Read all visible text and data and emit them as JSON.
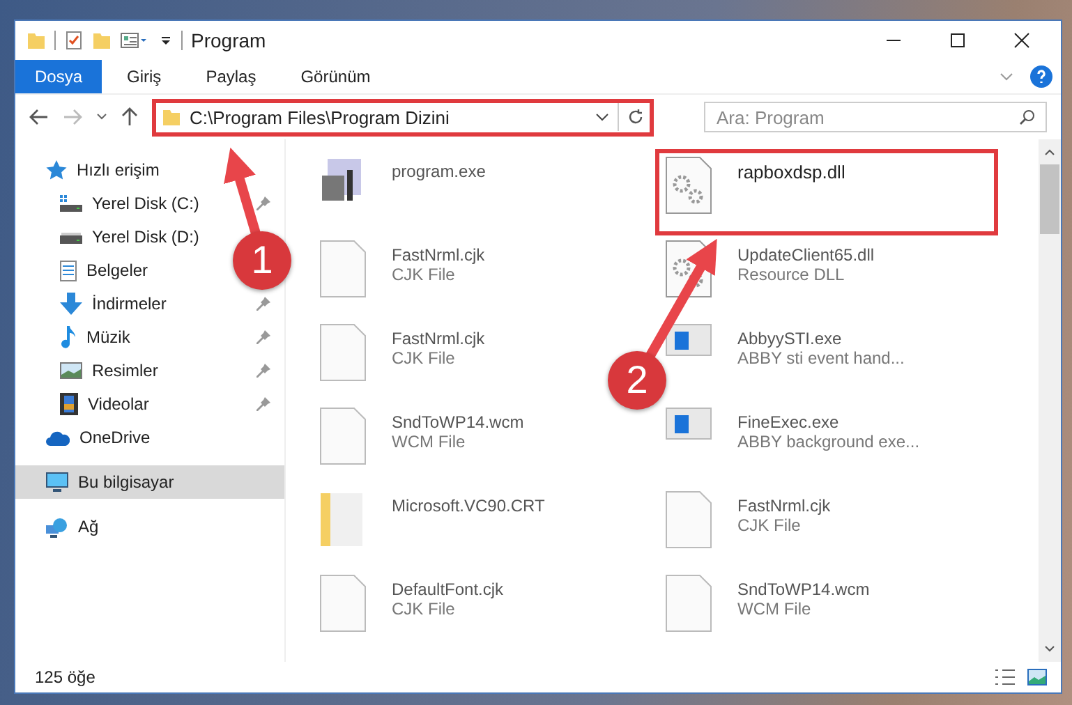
{
  "window": {
    "title": "Program"
  },
  "ribbon_tabs": [
    {
      "label": "Dosya",
      "selected": true
    },
    {
      "label": "Giriş",
      "selected": false
    },
    {
      "label": "Paylaş",
      "selected": false
    },
    {
      "label": "Görünüm",
      "selected": false
    }
  ],
  "address": {
    "path": "C:\\Program Files\\Program Dizini",
    "highlighted": true
  },
  "search": {
    "placeholder": "Ara: Program"
  },
  "sidebar": {
    "items": [
      {
        "label": "Hızlı erişim",
        "selected": false,
        "children": [
          {
            "label": "Yerel Disk (C:)",
            "pinned": true
          },
          {
            "label": "Yerel Disk (D:)",
            "pinned": false
          },
          {
            "label": "Belgeler",
            "pinned": false
          },
          {
            "label": "İndirmeler",
            "pinned": true
          },
          {
            "label": "Müzik",
            "pinned": true
          },
          {
            "label": "Resimler",
            "pinned": true
          },
          {
            "label": "Videolar",
            "pinned": true
          }
        ]
      },
      {
        "label": "OneDrive",
        "selected": false
      },
      {
        "label": "Bu bilgisayar",
        "selected": true
      },
      {
        "label": "Ağ",
        "selected": false
      }
    ]
  },
  "files": [
    {
      "name": "program.exe",
      "kind": "exe",
      "highlighted": false
    },
    {
      "name": "rapboxdsp.dll",
      "kind": "dll",
      "highlighted": true
    },
    {
      "name": "FastNrml.cjk",
      "type": "CJK File",
      "kind": "blank",
      "highlighted": false
    },
    {
      "name": "UpdateClient65.dll",
      "type": "Resource DLL",
      "kind": "dll",
      "highlighted": false
    },
    {
      "name": "FastNrml.cjk",
      "type": "CJK File",
      "kind": "blank",
      "highlighted": false
    },
    {
      "name": "AbbyySTI.exe",
      "type": "ABBY sti event hand...",
      "kind": "app",
      "highlighted": false
    },
    {
      "name": "SndToWP14.wcm",
      "type": "WCM File",
      "kind": "blank",
      "highlighted": false
    },
    {
      "name": "FineExec.exe",
      "type": "ABBY background exe...",
      "kind": "app",
      "highlighted": false
    },
    {
      "name": "Microsoft.VC90.CRT",
      "kind": "folder",
      "highlighted": false
    },
    {
      "name": "FastNrml.cjk",
      "type": "CJK File",
      "kind": "blank",
      "highlighted": false
    },
    {
      "name": "DefaultFont.cjk",
      "type": "CJK File",
      "kind": "blank",
      "highlighted": false
    },
    {
      "name": "SndToWP14.wcm",
      "type": "WCM File",
      "kind": "blank",
      "highlighted": false
    }
  ],
  "callouts": [
    {
      "number": "1"
    },
    {
      "number": "2"
    }
  ],
  "status_bar": {
    "item_count": "125 öğe"
  }
}
